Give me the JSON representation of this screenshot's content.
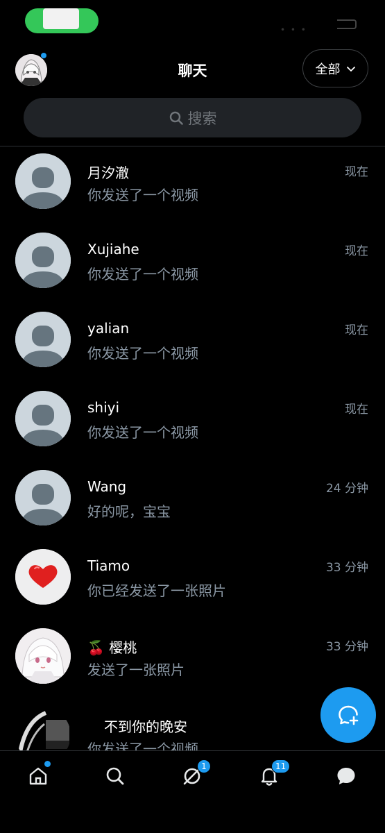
{
  "header": {
    "title": "聊天",
    "filter_label": "全部"
  },
  "search": {
    "placeholder": "搜索"
  },
  "chats": [
    {
      "name": "月汐澈",
      "preview": "你发送了一个视频",
      "time": "现在",
      "avatar": "default-avatar"
    },
    {
      "name": "Xujiahe",
      "preview": "你发送了一个视频",
      "time": "现在",
      "avatar": "default-avatar"
    },
    {
      "name": "yalian",
      "preview": "你发送了一个视频",
      "time": "现在",
      "avatar": "default-avatar"
    },
    {
      "name": "shiyi",
      "preview": "你发送了一个视频",
      "time": "现在",
      "avatar": "default-avatar"
    },
    {
      "name": "Wang",
      "preview": "好的呢，宝宝",
      "time": "24 分钟",
      "avatar": "default-avatar"
    },
    {
      "name": "Tiamo",
      "preview": "你已经发送了一张照片",
      "time": "33 分钟",
      "avatar": "heart-avatar"
    },
    {
      "name": "🍒 樱桃",
      "preview": "发送了一张照片",
      "time": "33 分钟",
      "avatar": "anime-avatar"
    },
    {
      "name": "不到你的晚安",
      "preview": "你发送了一个视频",
      "time": "",
      "avatar": "photo-avatar"
    }
  ],
  "bottom_nav": {
    "items": [
      "home-icon",
      "search-icon",
      "spaces-icon",
      "bell-icon",
      "messages-icon"
    ],
    "spaces_badge": "1",
    "notifications_badge": "11"
  },
  "colors": {
    "accent": "#1d9bf0",
    "background": "#000000",
    "secondary_text": "#8b98a5",
    "default_avatar_bg": "#ccd6dd",
    "default_avatar_fg": "#66757f"
  }
}
